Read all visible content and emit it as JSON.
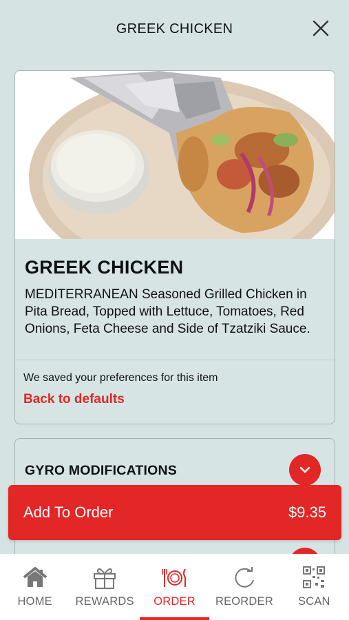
{
  "header": {
    "title": "GREEK CHICKEN"
  },
  "item": {
    "title": "GREEK CHICKEN",
    "description": "MEDITERRANEAN Seasoned Grilled Chicken in Pita Bread, Topped with Lettuce, Tomatoes, Red Onions, Feta Cheese and Side of Tzatziki Sauce.",
    "preferences_note": "We saved your preferences for this item",
    "defaults_link": "Back to defaults"
  },
  "modifications": {
    "label": "GYRO MODIFICATIONS"
  },
  "add_to_order": {
    "label": "Add To Order",
    "price": "$9.35"
  },
  "tabs": [
    {
      "label": "HOME",
      "icon": "home-icon",
      "active": false
    },
    {
      "label": "REWARDS",
      "icon": "gift-icon",
      "active": false
    },
    {
      "label": "ORDER",
      "icon": "plate-cutlery-icon",
      "active": true
    },
    {
      "label": "REORDER",
      "icon": "refresh-icon",
      "active": false
    },
    {
      "label": "SCAN",
      "icon": "qr-code-icon",
      "active": false
    }
  ],
  "colors": {
    "accent": "#e32626",
    "background": "#d5e3e3",
    "tab_inactive": "#666666"
  }
}
